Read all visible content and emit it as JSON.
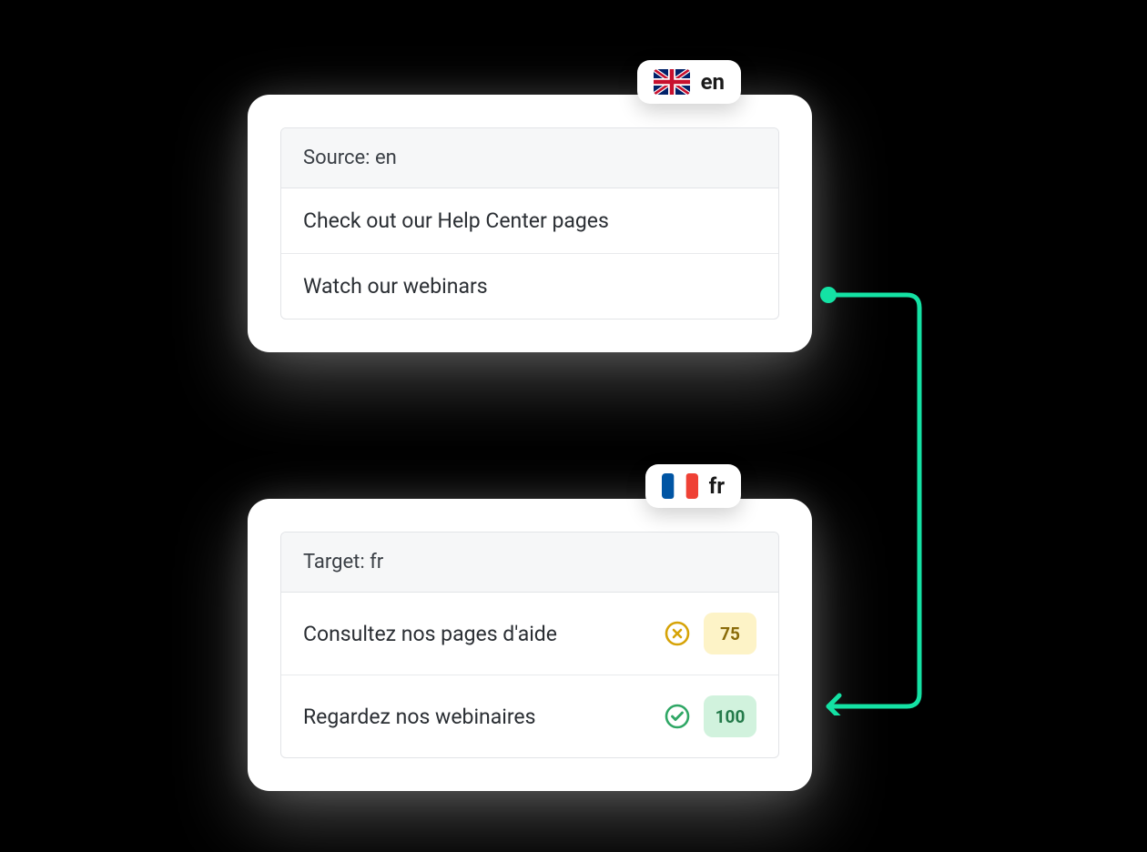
{
  "source": {
    "lang_code": "en",
    "header": "Source: en",
    "rows": [
      {
        "text": "Check out our Help Center pages"
      },
      {
        "text": "Watch our webinars"
      }
    ]
  },
  "target": {
    "lang_code": "fr",
    "header": "Target: fr",
    "rows": [
      {
        "text": "Consultez nos pages d'aide",
        "status": "warning",
        "score": "75"
      },
      {
        "text": "Regardez nos webinaires",
        "status": "success",
        "score": "100"
      }
    ]
  },
  "colors": {
    "connector": "#14e2a4",
    "warning_icon": "#d6a307",
    "success_icon": "#2fa765"
  }
}
